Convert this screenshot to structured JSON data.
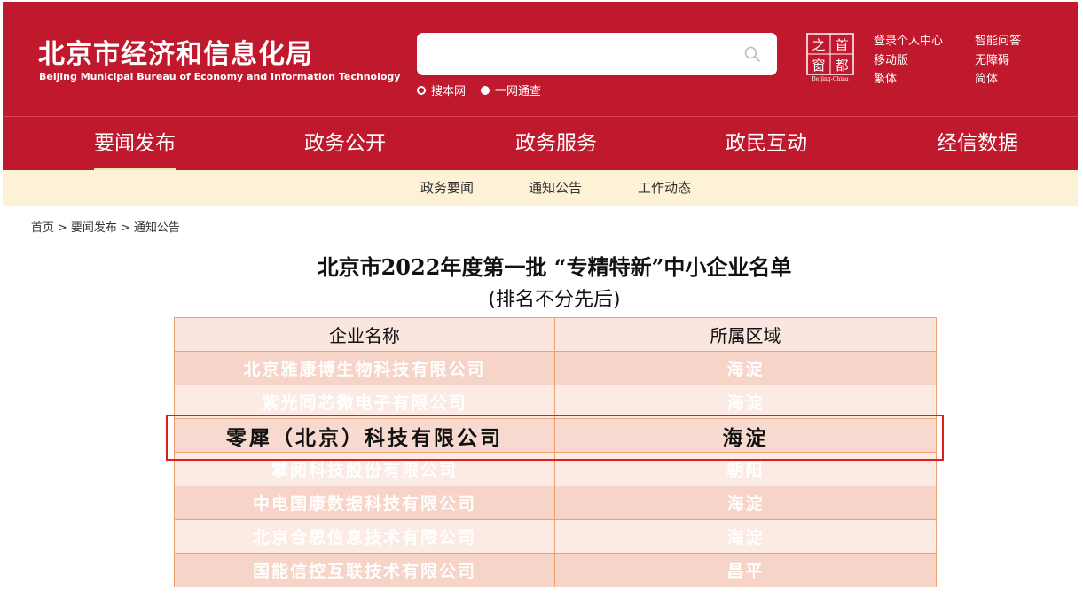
{
  "header": {
    "title_cn": "北京市经济和信息化局",
    "title_en": "Beijing Municipal Bureau of Economy and Information Technology",
    "search": {
      "value": "",
      "placeholder": ""
    },
    "scope_options": [
      "搜本网",
      "一网通查"
    ],
    "capital_logo": {
      "chars": [
        "之",
        "首",
        "窗",
        "都"
      ],
      "caption": "Beijing-China"
    },
    "links": [
      "登录个人中心",
      "智能问答",
      "移动版",
      "无障碍",
      "繁体",
      "简体"
    ]
  },
  "nav": {
    "items": [
      "要闻发布",
      "政务公开",
      "政务服务",
      "政民互动",
      "经信数据"
    ],
    "active_index": 0
  },
  "subnav": {
    "items": [
      "政务要闻",
      "通知公告",
      "工作动态"
    ]
  },
  "breadcrumb": {
    "items": [
      "首页",
      "要闻发布",
      "通知公告"
    ],
    "separator": ">"
  },
  "article": {
    "title": "北京市2022年度第一批 “专精特新”中小企业名单",
    "subtitle": "(排名不分先后)"
  },
  "table": {
    "headers": [
      "企业名称",
      "所属区域"
    ],
    "rows": [
      [
        "北京雅康博生物科技有限公司",
        "海淀"
      ],
      [
        "紫光同芯微电子有限公司",
        "海淀"
      ],
      [
        "零犀（北京）科技有限公司",
        "海淀"
      ],
      [
        "掌阅科技股份有限公司",
        "朝阳"
      ],
      [
        "中电国康数据科技有限公司",
        "海淀"
      ],
      [
        "北京合思信息技术有限公司",
        "海淀"
      ],
      [
        "国能信控互联技术有限公司",
        "昌平"
      ]
    ],
    "highlighted_row": 2
  },
  "colors": {
    "brand_red": "#c0182c",
    "subnav_bg": "#fdf2d6",
    "table_border": "#f0a070",
    "highlight_frame": "#dd1f1f"
  }
}
